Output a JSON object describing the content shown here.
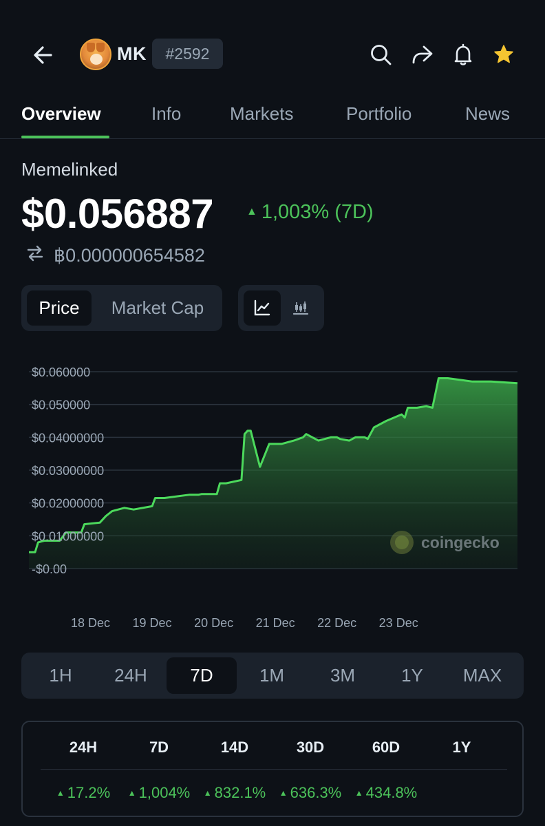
{
  "header": {
    "symbol": "MK",
    "rank": "#2592",
    "icons": [
      "back-arrow-icon",
      "search-icon",
      "share-icon",
      "bell-icon",
      "star-icon"
    ]
  },
  "tabs": [
    "Overview",
    "Info",
    "Markets",
    "Portfolio",
    "News"
  ],
  "coin": {
    "name": "Memelinked",
    "price": "$0.056887",
    "change": "1,003% (7D)",
    "btc_price": "฿0.000000654582"
  },
  "toggles": {
    "price": "Price",
    "market_cap": "Market Cap",
    "chart_types": [
      "line-chart-icon",
      "candlestick-icon"
    ]
  },
  "colors": {
    "accent_green": "#4cc25a",
    "background": "#0d1117"
  },
  "chart_data": {
    "type": "area",
    "y_tick_labels": [
      "$0.060000",
      "$0.050000",
      "$0.04000000",
      "$0.03000000",
      "$0.02000000",
      "$0.01000000",
      "-$0.00"
    ],
    "y_ticks": [
      0.06,
      0.05,
      0.04,
      0.03,
      0.02,
      0.01,
      0.0
    ],
    "ylim": [
      0,
      0.06
    ],
    "x_tick_labels": [
      "18 Dec",
      "19 Dec",
      "20 Dec",
      "21 Dec",
      "22 Dec",
      "23 Dec"
    ],
    "x_ticks": [
      17.0,
      18.0,
      19.0,
      20.0,
      21.0,
      22.0
    ],
    "xlim": [
      16.0,
      23.93
    ],
    "x": [
      16.0,
      16.1,
      16.15,
      16.25,
      16.5,
      16.6,
      16.85,
      16.9,
      17.15,
      17.25,
      17.35,
      17.45,
      17.55,
      17.7,
      18.0,
      18.05,
      18.2,
      18.6,
      18.75,
      18.8,
      19.05,
      19.1,
      19.2,
      19.45,
      19.5,
      19.55,
      19.6,
      19.75,
      19.9,
      20.1,
      20.3,
      20.45,
      20.5,
      20.7,
      20.9,
      21.0,
      21.05,
      21.2,
      21.3,
      21.45,
      21.5,
      21.6,
      21.8,
      22.05,
      22.1,
      22.15,
      22.3,
      22.45,
      22.55,
      22.65,
      22.8,
      23.0,
      23.2,
      23.5,
      23.93
    ],
    "values": [
      0.005,
      0.005,
      0.008,
      0.0085,
      0.0085,
      0.011,
      0.011,
      0.0135,
      0.014,
      0.016,
      0.0175,
      0.018,
      0.0185,
      0.018,
      0.019,
      0.0215,
      0.0215,
      0.0225,
      0.0225,
      0.0227,
      0.0227,
      0.026,
      0.026,
      0.027,
      0.041,
      0.042,
      0.042,
      0.031,
      0.038,
      0.038,
      0.039,
      0.04,
      0.041,
      0.039,
      0.04,
      0.04,
      0.0395,
      0.039,
      0.04,
      0.04,
      0.0395,
      0.043,
      0.045,
      0.047,
      0.046,
      0.049,
      0.049,
      0.0495,
      0.049,
      0.058,
      0.058,
      0.0575,
      0.057,
      0.057,
      0.0565
    ],
    "watermark": "coingecko",
    "grid": true
  },
  "ranges": [
    "1H",
    "24H",
    "7D",
    "1M",
    "3M",
    "1Y",
    "MAX"
  ],
  "active_range": "7D",
  "performance": {
    "headers": [
      "24H",
      "7D",
      "14D",
      "30D",
      "60D",
      "1Y"
    ],
    "values": [
      "17.2%",
      "1,004%",
      "832.1%",
      "636.3%",
      "434.8%",
      ""
    ]
  }
}
